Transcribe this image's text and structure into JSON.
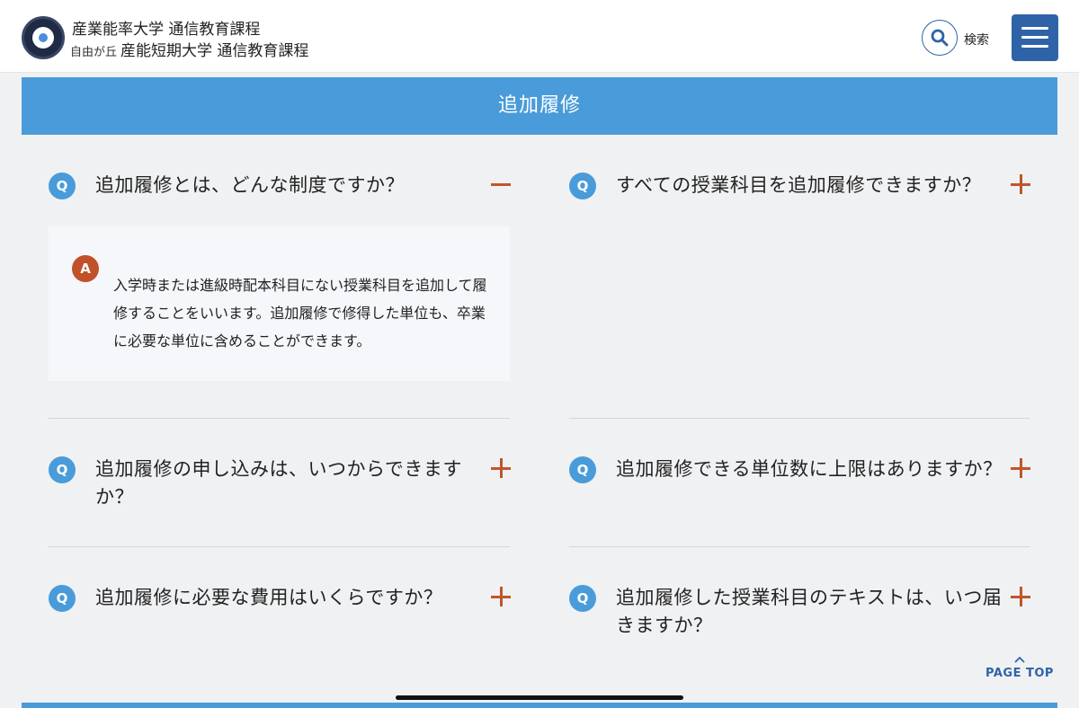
{
  "header": {
    "uni_line1": "産業能率大学 通信教育課程",
    "uni_line2_prefix": "自由が丘",
    "uni_line2_main": "産能短期大学 通信教育課程",
    "search_label": "検索"
  },
  "banner": {
    "title": "追加履修"
  },
  "faq": {
    "q_badge": "Q",
    "a_badge": "A",
    "left": [
      {
        "question": "追加履修とは、どんな制度ですか？",
        "expanded": true,
        "answer": "入学時または進級時配本科目にない授業科目を追加して履修することをいいます。追加履修で修得した単位も、卒業に必要な単位に含めることができます。"
      },
      {
        "question": "追加履修の申し込みは、いつからできますか？",
        "expanded": false
      },
      {
        "question": "追加履修に必要な費用はいくらですか？",
        "expanded": false
      }
    ],
    "right": [
      {
        "question": "すべての授業科目を追加履修できますか？",
        "expanded": false
      },
      {
        "question": "追加履修できる単位数に上限はありますか？",
        "expanded": false
      },
      {
        "question": "追加履修した授業科目のテキストは、いつ届きますか？",
        "expanded": false
      }
    ]
  },
  "page_top": {
    "label": "PAGE TOP"
  },
  "colors": {
    "accent_blue": "#4a9bd9",
    "brand_navy": "#2e63a8",
    "toggle_orange": "#c0562a"
  }
}
